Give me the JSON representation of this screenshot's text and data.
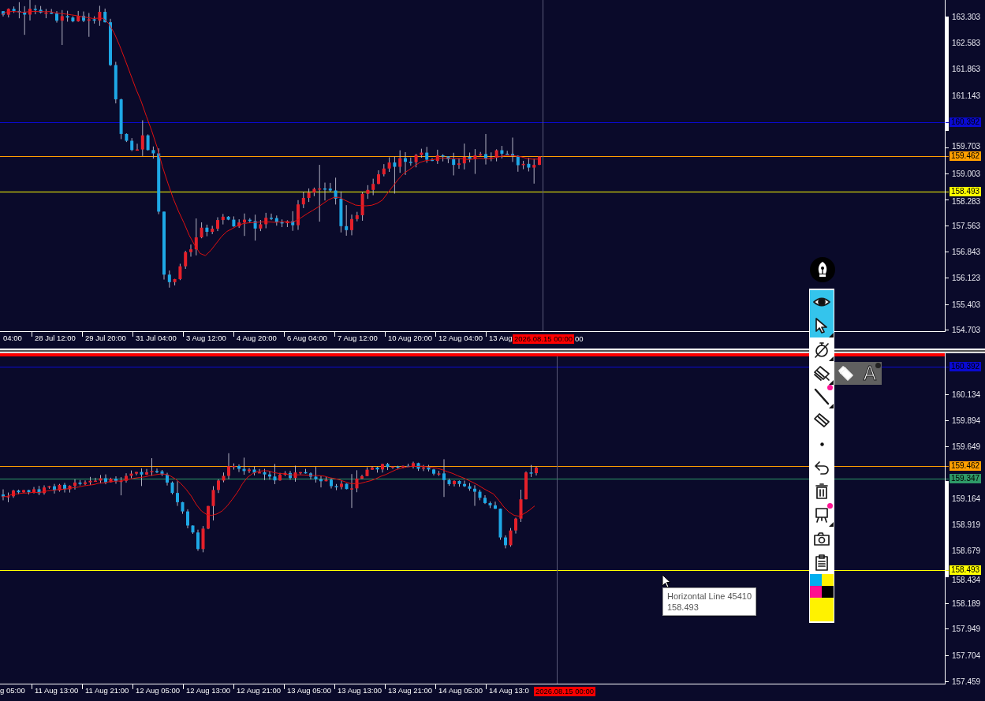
{
  "top_chart": {
    "price_ticks": [
      "163.303",
      "162.583",
      "161.863",
      "161.143",
      "159.703",
      "159.003",
      "158.283",
      "157.563",
      "156.843",
      "156.123",
      "155.403",
      "154.703"
    ],
    "levels": [
      {
        "label": "160.392",
        "color": "#0a0ad2"
      },
      {
        "label": "159.462",
        "color": "#ff9f00"
      },
      {
        "label": "158.493",
        "color": "#ffff00"
      }
    ],
    "time_axis": {
      "labels": [
        "04:00",
        "28 Jul 12:00",
        "29 Jul 20:00",
        "31 Jul 04:00",
        "3 Aug 12:00",
        "4 Aug 20:00",
        "6 Aug 04:00",
        "7 Aug 12:00",
        "10 Aug 20:00",
        "12 Aug 04:00",
        "13 Aug"
      ],
      "current": "2026.08.15 00:00",
      "trailing": "00"
    }
  },
  "bottom_chart": {
    "price_ticks": [
      "160.134",
      "159.894",
      "159.649",
      "159.164",
      "158.919",
      "158.679",
      "158.434",
      "158.189",
      "157.949",
      "157.704",
      "157.459"
    ],
    "levels": [
      {
        "label": "160.392",
        "color": "#0a0ad2"
      },
      {
        "label": "159.462",
        "color": "#ff9f00"
      },
      {
        "label": "159.347",
        "color": "#2e9a68"
      },
      {
        "label": "158.493",
        "color": "#ffff00"
      }
    ],
    "time_axis": {
      "labels": [
        "g 05:00",
        "11 Aug 13:00",
        "11 Aug 21:00",
        "12 Aug 05:00",
        "12 Aug 13:00",
        "12 Aug 21:00",
        "13 Aug 05:00",
        "13 Aug 13:00",
        "13 Aug 21:00",
        "14 Aug 05:00",
        "14 Aug 13:0"
      ],
      "current": "2026.08.15 00:00"
    }
  },
  "toolbar": {
    "tools": [
      {
        "kind": "eye",
        "selected": true,
        "submenu": false,
        "dot": false
      },
      {
        "kind": "cursor",
        "selected": true,
        "submenu": true,
        "dot": false
      },
      {
        "kind": "stopwatch",
        "selected": false,
        "submenu": true,
        "dot": false
      },
      {
        "kind": "eraser-stack",
        "selected": false,
        "submenu": true,
        "dot": false
      },
      {
        "kind": "line",
        "selected": false,
        "submenu": true,
        "dot": true
      },
      {
        "kind": "eraser",
        "selected": false,
        "submenu": false,
        "dot": false
      },
      {
        "kind": "dot",
        "selected": false,
        "submenu": false,
        "dot": false
      },
      {
        "kind": "undo",
        "selected": false,
        "submenu": false,
        "dot": false
      },
      {
        "kind": "trash",
        "selected": false,
        "submenu": false,
        "dot": false
      },
      {
        "kind": "easel",
        "selected": false,
        "submenu": true,
        "dot": true
      },
      {
        "kind": "camera",
        "selected": false,
        "submenu": false,
        "dot": false
      },
      {
        "kind": "clipboard",
        "selected": false,
        "submenu": false,
        "dot": false
      }
    ],
    "palette": [
      {
        "color": "#00aeef"
      },
      {
        "color": "#fff200"
      },
      {
        "color": "#ff0f8f"
      },
      {
        "color": "#000000"
      }
    ],
    "current_color": {
      "color": "#fff200"
    }
  },
  "popup": {
    "items": [
      {
        "kind": "marker",
        "dot": false
      },
      {
        "kind": "text",
        "label": "A",
        "dot": true
      }
    ]
  },
  "tooltip": {
    "lines": [
      "Horizontal Line 45410",
      "158.493"
    ]
  }
}
